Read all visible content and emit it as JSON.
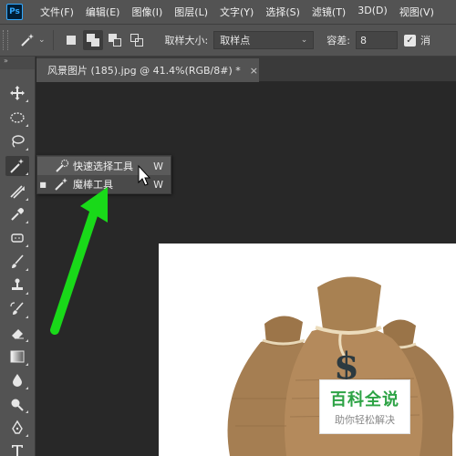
{
  "app": {
    "logo_text": "Ps"
  },
  "menu": {
    "items": [
      "文件(F)",
      "编辑(E)",
      "图像(I)",
      "图层(L)",
      "文字(Y)",
      "选择(S)",
      "滤镜(T)",
      "3D(D)",
      "视图(V)"
    ]
  },
  "options": {
    "sample_size_label": "取样大小:",
    "sample_size_value": "取样点",
    "tolerance_label": "容差:",
    "tolerance_value": "8",
    "antialias_label": "消",
    "antialias_checked": true
  },
  "document": {
    "tab_title": "风景图片 (185).jpg @ 41.4%(RGB/8#) *",
    "close_glyph": "×"
  },
  "toolbar": {
    "collapse_glyph": "»",
    "tools": [
      "move-tool",
      "marquee-tool",
      "lasso-tool",
      "magic-wand-tool",
      "crop-tool",
      "eyedropper-tool",
      "spot-healing-tool",
      "brush-tool",
      "clone-stamp-tool",
      "history-brush-tool",
      "eraser-tool",
      "gradient-tool",
      "blur-tool",
      "dodge-tool",
      "pen-tool",
      "type-tool"
    ]
  },
  "flyout": {
    "items": [
      {
        "label": "快速选择工具",
        "shortcut": "W",
        "hovered": true,
        "current": false
      },
      {
        "label": "魔棒工具",
        "shortcut": "W",
        "hovered": false,
        "current": true
      }
    ]
  },
  "image": {
    "watermark_title": "百科全说",
    "watermark_subtitle": "助你轻松解决",
    "bag_symbol": "$"
  },
  "colors": {
    "ui_panel": "#535353",
    "canvas_bg": "#282828",
    "arrow": "#19d919",
    "watermark_green": "#2da345"
  }
}
